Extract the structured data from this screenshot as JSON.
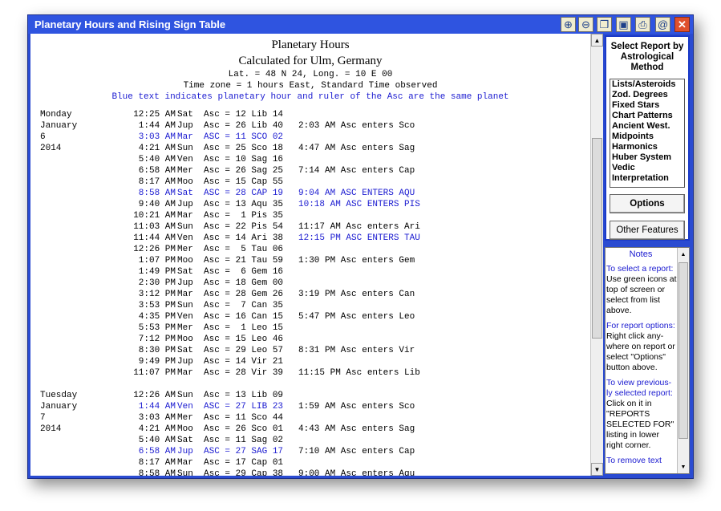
{
  "window": {
    "title": "Planetary Hours and Rising Sign Table",
    "toolbar": [
      {
        "name": "zoom-in-icon",
        "glyph": "⊕"
      },
      {
        "name": "zoom-out-icon",
        "glyph": "⊖"
      },
      {
        "name": "restore-window-icon",
        "glyph": "❐"
      },
      {
        "name": "save-disk-icon",
        "glyph": "▣"
      },
      {
        "name": "print-icon",
        "glyph": "⎙"
      },
      {
        "name": "email-icon",
        "glyph": "@"
      },
      {
        "name": "close-icon",
        "glyph": "✕"
      }
    ]
  },
  "report": {
    "title": "Planetary Hours",
    "subtitle": "Calculated for Ulm, Germany",
    "latlong": "Lat. = 48 N 24, Long. = 10 E 00",
    "timezone": "Time zone = 1 hours East, Standard Time observed",
    "note": "Blue text indicates planetary hour and ruler of the Asc are the same planet",
    "rows": [
      {
        "day": "Monday",
        "time": "12:25 AM",
        "planet": "Sat",
        "asc": "Asc = 12 Lib 14",
        "enters": "",
        "blue": false
      },
      {
        "day": "January",
        "time": "1:44 AM",
        "planet": "Jup",
        "asc": "Asc = 26 Lib 40",
        "enters": "2:03 AM Asc enters Sco",
        "blue": false
      },
      {
        "day": "6",
        "time": "3:03 AM",
        "planet": "Mar",
        "asc": "ASC = 11 SCO 02",
        "enters": "",
        "blue": true
      },
      {
        "day": "2014",
        "time": "4:21 AM",
        "planet": "Sun",
        "asc": "Asc = 25 Sco 18",
        "enters": "4:47 AM Asc enters Sag",
        "blue": false
      },
      {
        "day": "",
        "time": "5:40 AM",
        "planet": "Ven",
        "asc": "Asc = 10 Sag 16",
        "enters": "",
        "blue": false
      },
      {
        "day": "",
        "time": "6:58 AM",
        "planet": "Mer",
        "asc": "Asc = 26 Sag 25",
        "enters": "7:14 AM Asc enters Cap",
        "blue": false
      },
      {
        "day": "",
        "time": "8:17 AM",
        "planet": "Moo",
        "asc": "Asc = 15 Cap 55",
        "enters": "",
        "blue": false
      },
      {
        "day": "",
        "time": "8:58 AM",
        "planet": "Sat",
        "asc": "ASC = 28 CAP 19",
        "enters": "9:04 AM ASC ENTERS AQU",
        "blue": true
      },
      {
        "day": "",
        "time": "9:40 AM",
        "planet": "Jup",
        "asc": "Asc = 13 Aqu 35",
        "enters": "10:18 AM ASC ENTERS PIS",
        "blue": false,
        "enters_blue": true
      },
      {
        "day": "",
        "time": "10:21 AM",
        "planet": "Mar",
        "asc": "Asc =  1 Pis 35",
        "enters": "",
        "blue": false
      },
      {
        "day": "",
        "time": "11:03 AM",
        "planet": "Sun",
        "asc": "Asc = 22 Pis 54",
        "enters": "11:17 AM Asc enters Ari",
        "blue": false
      },
      {
        "day": "",
        "time": "11:44 AM",
        "planet": "Ven",
        "asc": "Asc = 14 Ari 38",
        "enters": "12:15 PM ASC ENTERS TAU",
        "blue": false,
        "enters_blue": true
      },
      {
        "day": "",
        "time": "12:26 PM",
        "planet": "Mer",
        "asc": "Asc =  5 Tau 06",
        "enters": "",
        "blue": false
      },
      {
        "day": "",
        "time": "1:07 PM",
        "planet": "Moo",
        "asc": "Asc = 21 Tau 59",
        "enters": "1:30 PM Asc enters Gem",
        "blue": false
      },
      {
        "day": "",
        "time": "1:49 PM",
        "planet": "Sat",
        "asc": "Asc =  6 Gem 16",
        "enters": "",
        "blue": false
      },
      {
        "day": "",
        "time": "2:30 PM",
        "planet": "Jup",
        "asc": "Asc = 18 Gem 00",
        "enters": "",
        "blue": false
      },
      {
        "day": "",
        "time": "3:12 PM",
        "planet": "Mar",
        "asc": "Asc = 28 Gem 26",
        "enters": "3:19 PM Asc enters Can",
        "blue": false
      },
      {
        "day": "",
        "time": "3:53 PM",
        "planet": "Sun",
        "asc": "Asc =  7 Can 35",
        "enters": "",
        "blue": false
      },
      {
        "day": "",
        "time": "4:35 PM",
        "planet": "Ven",
        "asc": "Asc = 16 Can 15",
        "enters": "5:47 PM Asc enters Leo",
        "blue": false
      },
      {
        "day": "",
        "time": "5:53 PM",
        "planet": "Mer",
        "asc": "Asc =  1 Leo 15",
        "enters": "",
        "blue": false
      },
      {
        "day": "",
        "time": "7:12 PM",
        "planet": "Moo",
        "asc": "Asc = 15 Leo 46",
        "enters": "",
        "blue": false
      },
      {
        "day": "",
        "time": "8:30 PM",
        "planet": "Sat",
        "asc": "Asc = 29 Leo 57",
        "enters": "8:31 PM Asc enters Vir",
        "blue": false
      },
      {
        "day": "",
        "time": "9:49 PM",
        "planet": "Jup",
        "asc": "Asc = 14 Vir 21",
        "enters": "",
        "blue": false
      },
      {
        "day": "",
        "time": "11:07 PM",
        "planet": "Mar",
        "asc": "Asc = 28 Vir 39",
        "enters": "11:15 PM Asc enters Lib",
        "blue": false
      },
      {
        "gap": true
      },
      {
        "day": "Tuesday",
        "time": "12:26 AM",
        "planet": "Sun",
        "asc": "Asc = 13 Lib 09",
        "enters": "",
        "blue": false
      },
      {
        "day": "January",
        "time": "1:44 AM",
        "planet": "Ven",
        "asc": "ASC = 27 LIB 23",
        "enters": "1:59 AM Asc enters Sco",
        "blue": true,
        "enters_blue": false
      },
      {
        "day": "7",
        "time": "3:03 AM",
        "planet": "Mer",
        "asc": "Asc = 11 Sco 44",
        "enters": "",
        "blue": false
      },
      {
        "day": "2014",
        "time": "4:21 AM",
        "planet": "Moo",
        "asc": "Asc = 26 Sco 01",
        "enters": "4:43 AM Asc enters Sag",
        "blue": false
      },
      {
        "day": "",
        "time": "5:40 AM",
        "planet": "Sat",
        "asc": "Asc = 11 Sag 02",
        "enters": "",
        "blue": false
      },
      {
        "day": "",
        "time": "6:58 AM",
        "planet": "Jup",
        "asc": "ASC = 27 SAG 17",
        "enters": "7:10 AM Asc enters Cap",
        "blue": true,
        "enters_blue": false
      },
      {
        "day": "",
        "time": "8:17 AM",
        "planet": "Mar",
        "asc": "Asc = 17 Cap 01",
        "enters": "",
        "blue": false
      },
      {
        "day": "",
        "time": "8:58 AM",
        "planet": "Sun",
        "asc": "Asc = 29 Cap 38",
        "enters": "9:00 AM Asc enters Aqu",
        "blue": false
      }
    ]
  },
  "side": {
    "panel_title": "Select Report by Astrological Method",
    "methods": [
      "Lists/Asteroids",
      "Zod. Degrees",
      "Fixed Stars",
      "Chart Patterns",
      "Ancient West.",
      "Midpoints",
      "Harmonics",
      "Huber System",
      "Vedic",
      "Interpretation"
    ],
    "options_label": "Options",
    "other_label": "Other Features"
  },
  "notes": {
    "title": "Notes",
    "items": [
      {
        "head": "To select a report:",
        "text": "Use green icons at top of screen or select from list above."
      },
      {
        "head": "For report options:",
        "text": "Right click any-where on report or select \"Options\" button above."
      },
      {
        "head": "To view previous-ly selected report:",
        "text": "Click on it in \"REPORTS SELECTED FOR\" listing in lower right corner."
      },
      {
        "head": "To remove text",
        "text": ""
      }
    ]
  },
  "colors": {
    "frame": "#2a4bd1",
    "blue_text": "#1a1ad0"
  }
}
